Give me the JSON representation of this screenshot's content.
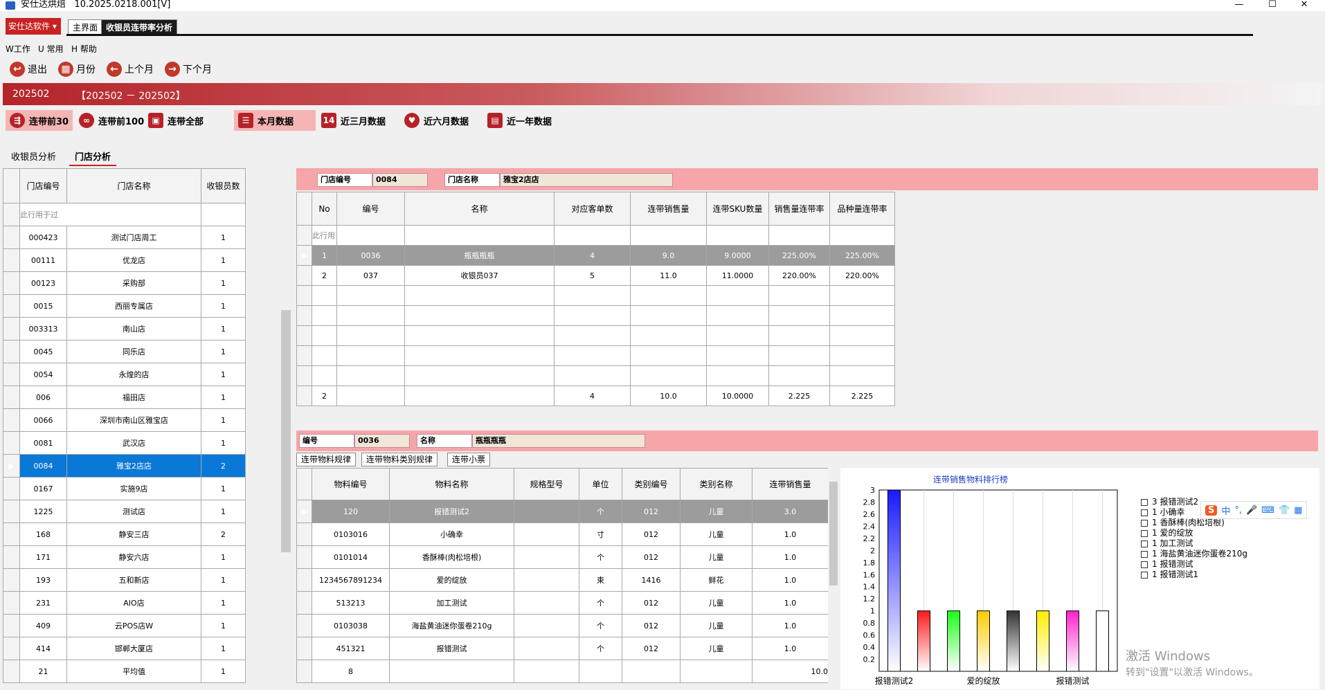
{
  "titlebar": {
    "app_name": "安仕达烘焙",
    "version": "10.2025.0218.001[V]",
    "min": "—",
    "max": "☐",
    "close": "✕"
  },
  "tabs": {
    "app_button": "安仕达软件 ▾",
    "home": "主界面",
    "active": "收银员连带率分析"
  },
  "menu": {
    "work": "W工作",
    "common": "U 常用",
    "help": "H 帮助"
  },
  "toolbar": {
    "exit": "退出",
    "month": "月份",
    "prev": "上个月",
    "next": "下个月"
  },
  "period": {
    "current": "202502",
    "range": "【202502 － 202502】"
  },
  "filters": {
    "top30": "连带前30",
    "top100": "连带前100",
    "all": "连带全部",
    "this_month": "本月数据",
    "three_months": "近三月数据",
    "six_months": "近六月数据",
    "one_year": "近一年数据"
  },
  "subtabs": {
    "cashier": "收银员分析",
    "store": "门店分析"
  },
  "stores": {
    "headers": [
      "门店编号",
      "门店名称",
      "收银员数"
    ],
    "filter_placeholder": "此行用于过",
    "rows": [
      [
        "000423",
        "测试门店周工",
        "1"
      ],
      [
        "00111",
        "优龙店",
        "1"
      ],
      [
        "00123",
        "采购部",
        "1"
      ],
      [
        "0015",
        "西丽专属店",
        "1"
      ],
      [
        "003313",
        "南山店",
        "1"
      ],
      [
        "0045",
        "同乐店",
        "1"
      ],
      [
        "0054",
        "永煌的店",
        "1"
      ],
      [
        "006",
        "福田店",
        "1"
      ],
      [
        "0066",
        "深圳市南山区雅宝店",
        "1"
      ],
      [
        "0081",
        "武汉店",
        "1"
      ],
      [
        "0084",
        "雅宝2店店",
        "2"
      ],
      [
        "0167",
        "实施9店",
        "1"
      ],
      [
        "1225",
        "测试店",
        "1"
      ],
      [
        "168",
        "静安三店",
        "2"
      ],
      [
        "171",
        "静安六店",
        "1"
      ],
      [
        "193",
        "五和新店",
        "1"
      ],
      [
        "231",
        "AIO店",
        "1"
      ],
      [
        "409",
        "云POS店W",
        "1"
      ],
      [
        "414",
        "邯郸大厦店",
        "1"
      ]
    ],
    "footer": [
      "21",
      "平均值",
      "1"
    ]
  },
  "store_info": {
    "code_label": "门店编号",
    "code": "0084",
    "name_label": "门店名称",
    "name": "雅宝2店店"
  },
  "cashiers": {
    "headers": [
      "No",
      "编号",
      "名称",
      "对应客单数",
      "连带销售量",
      "连带SKU数量",
      "销售量连带率",
      "品种量连带率"
    ],
    "filter_placeholder": "此行用",
    "rows": [
      [
        "1",
        "0036",
        "瓶瓶瓶瓶",
        "4",
        "9.0",
        "9.0000",
        "225.00%",
        "225.00%"
      ],
      [
        "2",
        "037",
        "收银员037",
        "5",
        "11.0",
        "11.0000",
        "220.00%",
        "220.00%"
      ]
    ],
    "footer": [
      "2",
      "",
      "",
      "4",
      "10.0",
      "10.0000",
      "2.225",
      "2.225"
    ]
  },
  "cashier_info": {
    "code_label": "编号",
    "code": "0036",
    "name_label": "名称",
    "name": "瓶瓶瓶瓶"
  },
  "detail_tabs": [
    "连带物料规律",
    "连带物料类别规律",
    "连带小票"
  ],
  "items": {
    "headers": [
      "物料编号",
      "物料名称",
      "规格型号",
      "单位",
      "类别编号",
      "类别名称",
      "连带销售量"
    ],
    "rows": [
      [
        "120",
        "报错测试2",
        "",
        "个",
        "012",
        "儿童",
        "3.0"
      ],
      [
        "0103016",
        "小确幸",
        "",
        "寸",
        "012",
        "儿童",
        "1.0"
      ],
      [
        "0101014",
        "香酥棒(肉松培根)",
        "",
        "个",
        "012",
        "儿童",
        "1.0"
      ],
      [
        "1234567891234",
        "爱的绽放",
        "",
        "束",
        "1416",
        "鲜花",
        "1.0"
      ],
      [
        "513213",
        "加工测试",
        "",
        "个",
        "012",
        "儿童",
        "1.0"
      ],
      [
        "0103038",
        "海盐黄油迷你蛋卷210g",
        "",
        "个",
        "012",
        "儿童",
        "1.0"
      ],
      [
        "451321",
        "报错测试",
        "",
        "个",
        "012",
        "儿童",
        "1.0"
      ]
    ],
    "footer": [
      "8",
      "",
      "",
      "",
      "",
      "",
      "10.0"
    ]
  },
  "chart_data": {
    "type": "bar",
    "title": "连带销售物料排行榜",
    "categories": [
      "报错测试2",
      "小确幸",
      "香酥棒(肉松培根)",
      "爱的绽放",
      "加工测试",
      "海盐黄油迷你蛋卷210g",
      "报错测试",
      "报错测试1"
    ],
    "values": [
      3,
      1,
      1,
      1,
      1,
      1,
      1,
      1
    ],
    "colors": [
      "#1a1aff",
      "#ff1a1a",
      "#1aff1a",
      "#ffcc00",
      "#333333",
      "#ffee00",
      "#ff22cc",
      "#ffffff"
    ],
    "xtick_labels": [
      "报错测试2",
      "爱的绽放",
      "报错测试"
    ],
    "yticks": [
      "3",
      "2.8",
      "2.6",
      "2.4",
      "2.2",
      "2",
      "1.8",
      "1.6",
      "1.4",
      "1.2",
      "1",
      "0.8",
      "0.6",
      "0.4",
      "0.2"
    ],
    "ylim": [
      0,
      3
    ],
    "legend": [
      "3 报错测试2",
      "1 小确幸",
      "1 香酥棒(肉松培根)",
      "1 爱的绽放",
      "1 加工测试",
      "1 海盐黄油迷你蛋卷210g",
      "1 报错测试",
      "1 报错测试1"
    ],
    "legend_position": "right"
  },
  "watermark": {
    "line1": "激活 Windows",
    "line2": "转到\"设置\"以激活 Windows。"
  },
  "ime": {
    "logo": "S",
    "lang": "中"
  }
}
